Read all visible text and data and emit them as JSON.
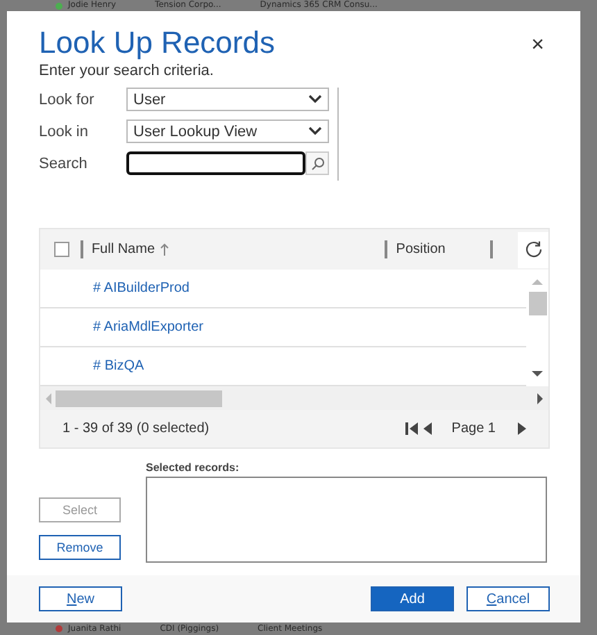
{
  "background": {
    "top_row": [
      "Jodie Henry",
      "Tension Corpo...",
      "Dynamics 365 CRM Consu..."
    ],
    "bottom_row": [
      "Juanita Rathi",
      "CDI (Piggings)",
      "Client Meetings"
    ]
  },
  "dialog": {
    "title": "Look Up Records",
    "subtitle": "Enter your search criteria.",
    "close": "×",
    "fields": [
      {
        "label": "Look for",
        "kind": "select",
        "value": "User"
      },
      {
        "label": "Look in",
        "kind": "select",
        "value": "User Lookup View"
      },
      {
        "label": "Search",
        "kind": "search",
        "focused": true
      }
    ],
    "grid": {
      "columns": [
        {
          "label": "Full Name",
          "sorted_ascending": true
        },
        {
          "label": "Position",
          "sorted_ascending": false
        },
        {
          "sorted_ascending": false
        }
      ],
      "rows": [
        {
          "name": "# AIBuilderProd",
          "selected": false
        },
        {
          "name": "# AriaMdlExporter",
          "selected": false
        },
        {
          "name": "# BizQA",
          "selected": false
        }
      ],
      "all_checked": false,
      "status": "1 - 39 of 39 (0 selected)",
      "page": "Page 1"
    },
    "selected_records": {
      "label": "Selected records:"
    },
    "side_buttons": [
      {
        "label": "Select",
        "disabled": true
      },
      {
        "label": "Remove",
        "disabled": false
      }
    ],
    "footer_buttons": [
      {
        "label": "New",
        "kind": "secondary",
        "access_key": true
      },
      {
        "label": "Add",
        "kind": "primary",
        "access_key": false
      },
      {
        "label": "Cancel",
        "kind": "secondary",
        "access_key": true
      }
    ]
  }
}
